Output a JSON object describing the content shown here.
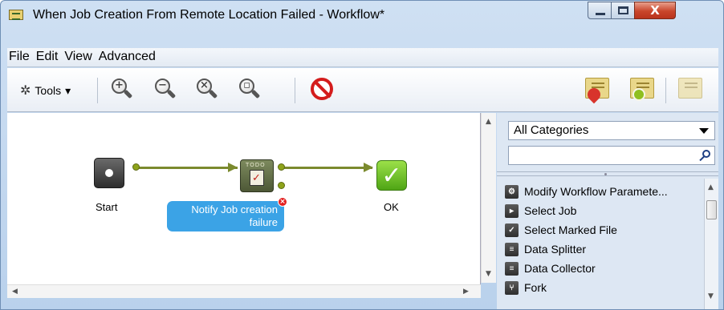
{
  "window": {
    "title": "When Job Creation From Remote Location Failed - Workflow*",
    "controls": {
      "minimize": "minimize",
      "maximize": "maximize",
      "close_label": "X"
    }
  },
  "menu": [
    "File",
    "Edit",
    "View",
    "Advanced"
  ],
  "toolbar": {
    "tools_label": "Tools",
    "tools_arrow": "▾",
    "zoom_buttons": [
      "zoom-in-icon",
      "zoom-out-icon",
      "zoom-reset-icon",
      "zoom-fit-icon"
    ],
    "zoom_symbols": [
      "+",
      "−",
      "×",
      "▫"
    ],
    "right_icons": [
      "favorite-ticket-icon",
      "add-ticket-icon",
      "ticket-icon"
    ]
  },
  "canvas": {
    "nodes": [
      {
        "name": "start",
        "label": "Start"
      },
      {
        "name": "todo",
        "label": "Notify Job creation failure",
        "label_line1": "Notify Job creation",
        "label_line2": "failure",
        "icon_text": "TODO"
      },
      {
        "name": "ok",
        "label": "OK"
      }
    ]
  },
  "panel": {
    "category": "All Categories",
    "search_placeholder": "",
    "items": [
      "Modify Workflow Paramete...",
      "Select Job",
      "Select Marked File",
      "Data Splitter",
      "Data Collector",
      "Fork"
    ]
  },
  "colors": {
    "connector": "#7b8a2e",
    "label_bubble": "#3ba3e6",
    "ok_node": "#5fb81f",
    "stop": "#d41c1c"
  }
}
